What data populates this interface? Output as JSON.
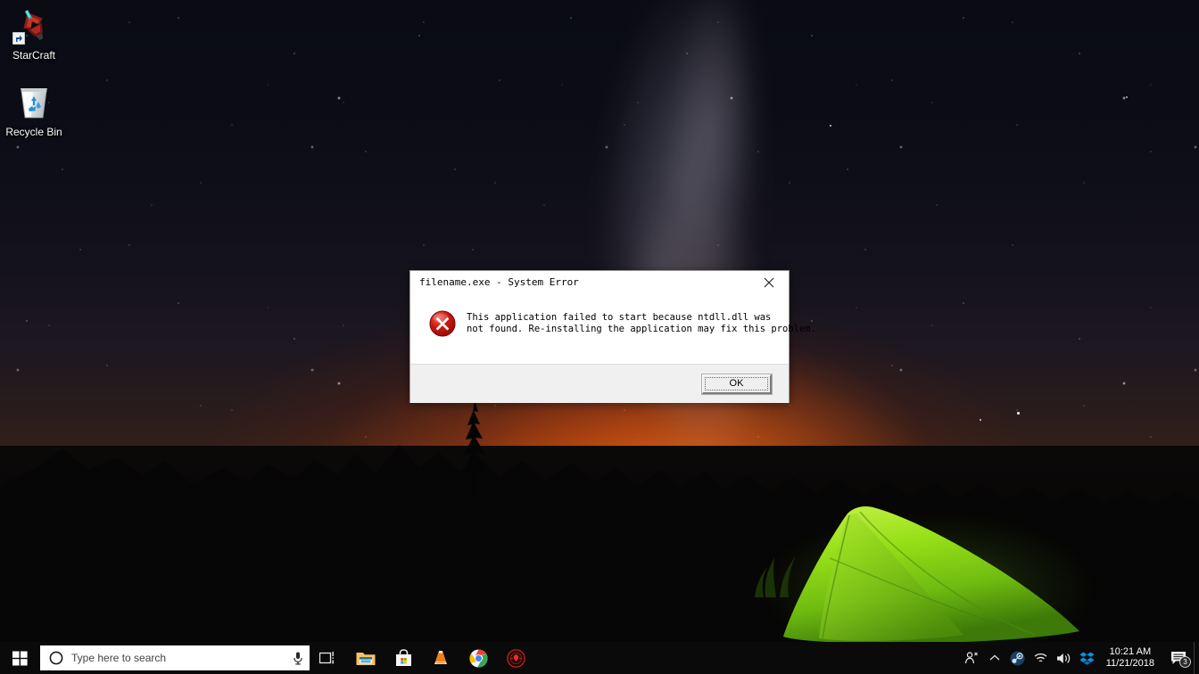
{
  "desktop": {
    "wallpaper_description": "Night sky with Milky Way over dark mountain silhouettes, orange sunset glow at horizon, and a glowing green tent",
    "icons": [
      {
        "name": "StarCraft",
        "label": "StarCraft",
        "icon": "starcraft-shortcut-icon"
      },
      {
        "name": "Recycle Bin",
        "label": "Recycle Bin",
        "icon": "recycle-bin-icon"
      }
    ]
  },
  "dialog": {
    "title": "filename.exe - System Error",
    "icon": "error-icon",
    "message_line1": "This application failed to start because ntdll.dll was",
    "message_line2": "not found. Re-installing the application may fix this problem.",
    "close_label": "✕",
    "buttons": [
      {
        "label": "OK",
        "name": "ok-button",
        "default": true
      }
    ]
  },
  "taskbar": {
    "start": {
      "label": "Start",
      "icon": "windows-logo-icon"
    },
    "search": {
      "placeholder": "Type here to search",
      "cortana_icon": "cortana-circle-icon",
      "mic_icon": "microphone-icon"
    },
    "task_view": {
      "label": "Task View",
      "icon": "task-view-icon"
    },
    "pinned": [
      {
        "label": "File Explorer",
        "icon": "file-explorer-icon"
      },
      {
        "label": "Microsoft Store",
        "icon": "microsoft-store-icon"
      },
      {
        "label": "VLC media player",
        "icon": "vlc-cone-icon"
      },
      {
        "label": "Google Chrome",
        "icon": "chrome-icon"
      },
      {
        "label": "Game Launcher",
        "icon": "red-circle-game-icon"
      }
    ],
    "tray": [
      {
        "label": "People",
        "icon": "people-icon"
      },
      {
        "label": "Show hidden icons",
        "icon": "chevron-up-icon"
      },
      {
        "label": "Steam",
        "icon": "steam-icon"
      },
      {
        "label": "Network",
        "icon": "wifi-icon"
      },
      {
        "label": "Volume",
        "icon": "speaker-icon"
      },
      {
        "label": "Dropbox",
        "icon": "dropbox-icon"
      }
    ],
    "clock": {
      "time": "10:21 AM",
      "date": "11/21/2018"
    },
    "action_center": {
      "label": "Action Center",
      "icon": "speech-bubble-icon",
      "badge_count": "3"
    }
  },
  "colors": {
    "taskbar_bg": "#0a0a0a",
    "dialog_bg": "#ffffff",
    "dialog_footer_bg": "#f0f0f0",
    "error_red": "#cc0000",
    "tent_green": "#8ce01e",
    "sunset_orange": "#ff600a"
  }
}
